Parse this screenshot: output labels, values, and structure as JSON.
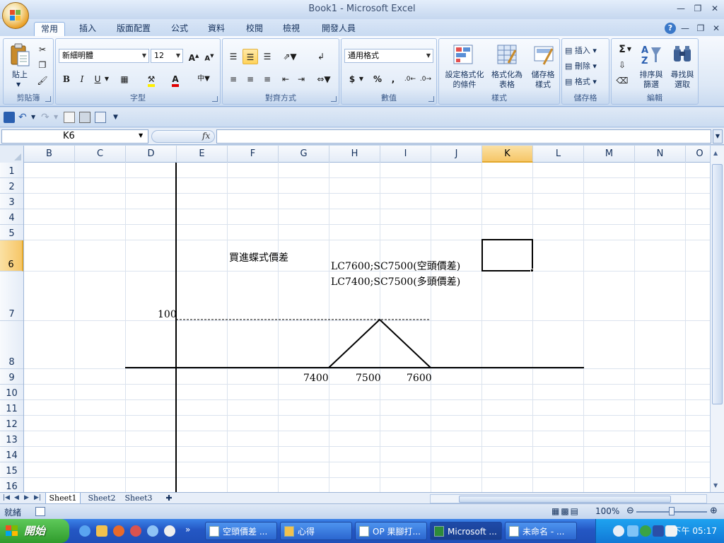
{
  "window": {
    "title": "Book1 - Microsoft Excel"
  },
  "ribbon_tabs": [
    "常用",
    "插入",
    "版面配置",
    "公式",
    "資料",
    "校閱",
    "檢視",
    "開發人員"
  ],
  "ribbon": {
    "clipboard": {
      "label": "剪貼簿",
      "paste": "貼上"
    },
    "font": {
      "label": "字型",
      "font_name": "新細明體",
      "font_size": "12"
    },
    "alignment": {
      "label": "對齊方式"
    },
    "number": {
      "label": "數值",
      "format": "通用格式",
      "currency": "$",
      "percent": "%",
      "comma": ","
    },
    "styles": {
      "label": "樣式",
      "conditional_1": "設定格式化",
      "conditional_2": "的條件",
      "table_1": "格式化為",
      "table_2": "表格",
      "cell_1": "儲存格",
      "cell_2": "樣式"
    },
    "cells": {
      "label": "儲存格",
      "insert": "插入",
      "delete": "刪除",
      "format": "格式"
    },
    "editing": {
      "label": "編輯",
      "sort_1": "排序與",
      "sort_2": "篩選",
      "find_1": "尋找與",
      "find_2": "選取"
    }
  },
  "formula_bar": {
    "name_box": "K6",
    "fx": "fx",
    "value": ""
  },
  "grid": {
    "columns": [
      "B",
      "C",
      "D",
      "E",
      "F",
      "G",
      "H",
      "I",
      "J",
      "K",
      "L",
      "M",
      "N",
      "O"
    ],
    "rows": [
      "1",
      "2",
      "3",
      "4",
      "5",
      "6",
      "7",
      "8",
      "9",
      "10",
      "11",
      "12",
      "13",
      "14",
      "15",
      "16"
    ],
    "active_column": "K",
    "active_row": "6",
    "texts": {
      "title": "買進蝶式價差",
      "note1": "LC7600;SC7500(空頭價差)",
      "note2": "LC7400;SC7500(多頭價差)",
      "y100": "100",
      "x7400": "7400",
      "x7500": "7500",
      "x7600": "7600"
    }
  },
  "chart_data": {
    "type": "line",
    "title": "買進蝶式價差",
    "x": [
      7400,
      7500,
      7600
    ],
    "series": [
      {
        "values": [
          0,
          100,
          0
        ]
      }
    ],
    "xlabel": "",
    "ylabel": "",
    "ylim": [
      0,
      100
    ],
    "annotations": [
      "LC7600;SC7500(空頭價差)",
      "LC7400;SC7500(多頭價差)"
    ],
    "reference_line_y": 100
  },
  "sheets": [
    "Sheet1",
    "Sheet2",
    "Sheet3"
  ],
  "active_sheet": "Sheet1",
  "status": {
    "ready": "就緒",
    "zoom": "100%"
  },
  "taskbar": {
    "start": "開始",
    "tasks": [
      "空頭價差 ...",
      "心得",
      "OP 果腳打...",
      "Microsoft ...",
      "未命名 - ..."
    ],
    "active_task": 3,
    "clock": "下午 05:17"
  },
  "colors": {
    "accent": "#2457c4",
    "selected_header": "#f6c667",
    "ribbon": "#dde8f6"
  }
}
